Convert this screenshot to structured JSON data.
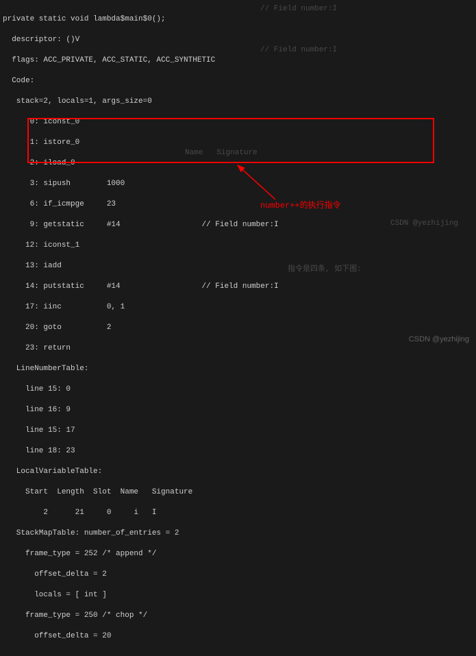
{
  "lines": {
    "l1": "private static void lambda$main$0();",
    "l2": "  descriptor: ()V",
    "l3": "  flags: ACC_PRIVATE, ACC_STATIC, ACC_SYNTHETIC",
    "l4": "  Code:",
    "l5": "   stack=2, locals=1, args_size=0",
    "l6": "      0: iconst_0",
    "l7": "      1: istore_0",
    "l8": "      2: iload_0",
    "l9": "      3: sipush        1000",
    "l10": "      6: if_icmpge     23",
    "l11": "      9: getstatic     #14                  // Field number:I",
    "l12": "     12: iconst_1",
    "l13": "     13: iadd",
    "l14": "     14: putstatic     #14                  // Field number:I",
    "l15": "     17: iinc          0, 1",
    "l16": "     20: goto          2",
    "l17": "     23: return",
    "l18": "   LineNumberTable:",
    "l19": "     line 15: 0",
    "l20": "     line 16: 9",
    "l21": "     line 15: 17",
    "l22": "     line 18: 23",
    "l23": "   LocalVariableTable:",
    "l24": "     Start  Length  Slot  Name   Signature",
    "l25": "         2      21     0     i   I",
    "l26": "   StackMapTable: number_of_entries = 2",
    "l27": "     frame_type = 252 /* append */",
    "l28": "       offset_delta = 2",
    "l29": "       locals = [ int ]",
    "l30": "     frame_type = 250 /* chop */",
    "l31": "       offset_delta = 20"
  },
  "annotation": "number++的执行指令",
  "watermark": "CSDN @yezhijing",
  "ghost": {
    "g1": "// Field number:I",
    "g2": "// Field number:I",
    "g3": "Name   Signature",
    "g4": "指令是四条, 如下图:",
    "g5": "CSDN @yezhijing"
  }
}
